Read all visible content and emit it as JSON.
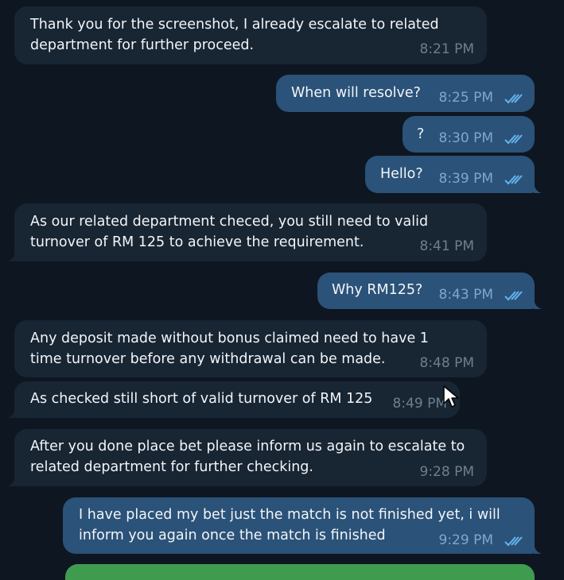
{
  "messages": [
    {
      "side": "in",
      "lines": [
        "Thank you for the screenshot, I already escalate to related",
        "department for further proceed."
      ],
      "time": "8:21 PM"
    },
    {
      "side": "out",
      "lines": [
        "When will resolve?"
      ],
      "time": "8:25 PM",
      "read": true
    },
    {
      "side": "out",
      "lines": [
        "?"
      ],
      "time": "8:30 PM",
      "read": true
    },
    {
      "side": "out",
      "lines": [
        "Hello?"
      ],
      "time": "8:39 PM",
      "read": true
    },
    {
      "side": "in",
      "lines": [
        "As our related department checed, you still need to valid",
        "turnover of RM 125 to achieve the requirement."
      ],
      "time": "8:41 PM"
    },
    {
      "side": "out",
      "lines": [
        "Why RM125?"
      ],
      "time": "8:43 PM",
      "read": true
    },
    {
      "side": "in",
      "lines": [
        "Any deposit made without bonus claimed need to have 1",
        "time turnover before any withdrawal can be made."
      ],
      "time": "8:48 PM"
    },
    {
      "side": "in",
      "lines": [
        "As checked still short of valid turnover of RM 125"
      ],
      "time": "8:49 PM"
    },
    {
      "side": "in",
      "lines": [
        "After you done place bet please inform us again to escalate to",
        "related department for further checking."
      ],
      "time": "9:28 PM"
    },
    {
      "side": "out",
      "lines": [
        "I have placed my bet just the match is not finished yet, i will",
        "inform you again once the match is finished"
      ],
      "time": "9:29 PM",
      "read": true
    }
  ],
  "colors": {
    "background": "#0e1621",
    "incoming_bubble": "#182533",
    "outgoing_bubble": "#2b5278",
    "read_check": "#64b5ef",
    "peek_bar": "#3f9c4f"
  }
}
